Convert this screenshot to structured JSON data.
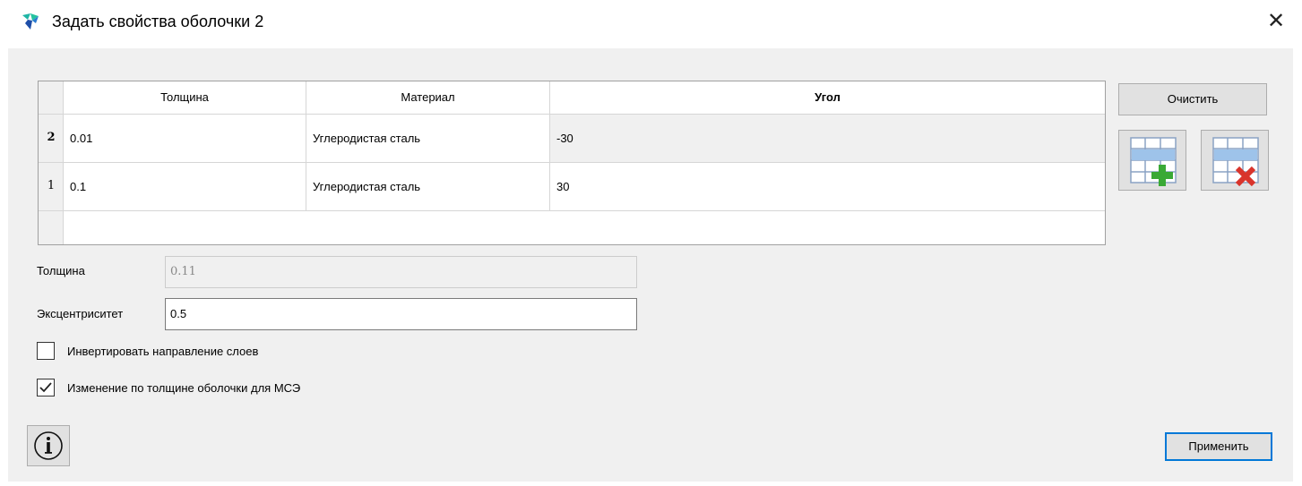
{
  "window": {
    "title": "Задать свойства оболочки 2",
    "close_glyph": "✕",
    "logo_icon": "app-logo-icon"
  },
  "layers_table": {
    "columns": [
      "Толщина",
      "Материал",
      "Угол"
    ],
    "rows": [
      {
        "num": "2",
        "thickness": "0.01",
        "material": "Углеродистая сталь",
        "angle": "-30"
      },
      {
        "num": "1",
        "thickness": "0.1",
        "material": "Углеродистая сталь",
        "angle": "30"
      }
    ]
  },
  "side_buttons": {
    "clear_label": "Очистить",
    "add_row_icon": "table-add-row-icon",
    "delete_row_icon": "table-delete-row-icon"
  },
  "form": {
    "thickness_label": "Толщина",
    "thickness_value": "0.11",
    "eccentricity_label": "Эксцентриситет",
    "eccentricity_value": "0.5",
    "invert_layers_label": "Инвертировать направление слоев",
    "invert_layers_checked": false,
    "thickness_change_label": "Изменение по толщине оболочки для МСЭ",
    "thickness_change_checked": true
  },
  "footer": {
    "info_icon": "info-icon",
    "apply_label": "Применить"
  },
  "colors": {
    "accent": "#0078d7",
    "logo_teal": "#1fb5a5",
    "logo_blue": "#1e4ea8",
    "add_green": "#3aa935",
    "delete_red": "#d9342b"
  }
}
